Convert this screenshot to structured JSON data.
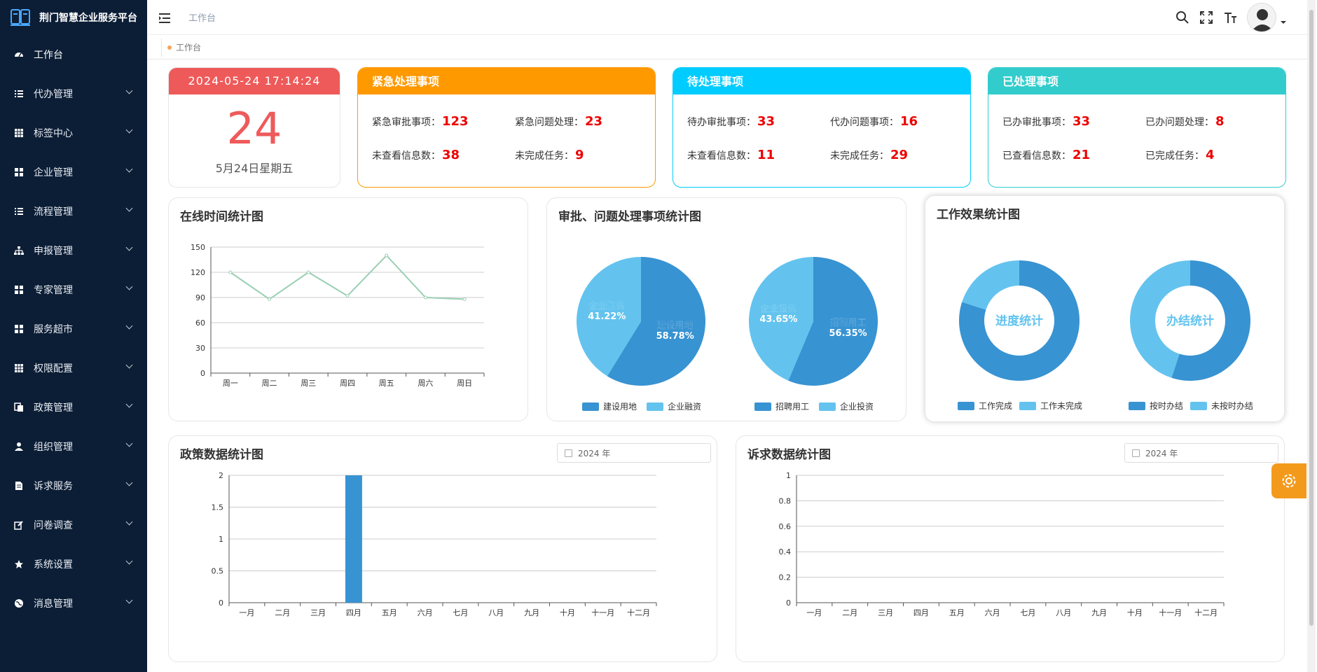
{
  "app": {
    "title": "荆门智慧企业服务平台"
  },
  "sidebar": {
    "items": [
      {
        "label": "工作台",
        "icon": "dashboard-icon",
        "active": true
      },
      {
        "label": "代办管理",
        "icon": "list-icon"
      },
      {
        "label": "标签中心",
        "icon": "grid-icon"
      },
      {
        "label": "企业管理",
        "icon": "apps-icon"
      },
      {
        "label": "流程管理",
        "icon": "list-icon"
      },
      {
        "label": "申报管理",
        "icon": "tree-icon"
      },
      {
        "label": "专家管理",
        "icon": "apps-icon"
      },
      {
        "label": "服务超市",
        "icon": "apps-icon"
      },
      {
        "label": "权限配置",
        "icon": "grid-icon"
      },
      {
        "label": "政策管理",
        "icon": "copy-icon"
      },
      {
        "label": "组织管理",
        "icon": "user-icon"
      },
      {
        "label": "诉求服务",
        "icon": "file-icon"
      },
      {
        "label": "问卷调查",
        "icon": "edit-icon"
      },
      {
        "label": "系统设置",
        "icon": "star-icon"
      },
      {
        "label": "消息管理",
        "icon": "globe-icon"
      }
    ]
  },
  "topbar": {
    "breadcrumb": "工作台"
  },
  "tags": {
    "items": [
      {
        "label": "工作台"
      }
    ]
  },
  "date_card": {
    "datetime": "2024-05-24 17:14:24",
    "day": "24",
    "date_line": "5月24日星期五"
  },
  "stat_cards": [
    {
      "title": "紧急处理事项",
      "color": "#ff9900",
      "items": [
        {
          "label": "紧急审批事项：",
          "value": "123"
        },
        {
          "label": "紧急问题处理：",
          "value": "23"
        },
        {
          "label": "未查看信息数：",
          "value": "38"
        },
        {
          "label": "未完成任务：",
          "value": "9"
        }
      ]
    },
    {
      "title": "待处理事项",
      "color": "#00ccff",
      "items": [
        {
          "label": "待办审批事项：",
          "value": "33"
        },
        {
          "label": "代办问题事项：",
          "value": "16"
        },
        {
          "label": "未查看信息数：",
          "value": "11"
        },
        {
          "label": "未完成任务：",
          "value": "29"
        }
      ]
    },
    {
      "title": "已处理事项",
      "color": "#33cccc",
      "items": [
        {
          "label": "已办审批事项：",
          "value": "33"
        },
        {
          "label": "已办问题处理：",
          "value": "8"
        },
        {
          "label": "已查看信息数：",
          "value": "21"
        },
        {
          "label": "已完成任务：",
          "value": "4"
        }
      ]
    }
  ],
  "colors": {
    "dark_blue": "#3893d2",
    "light_blue": "#63c3ee",
    "line": "#9ad0b4",
    "sidebar_bg": "#0c1e36"
  },
  "chart_data": [
    {
      "type": "line",
      "title": "在线时间统计图",
      "categories": [
        "周一",
        "周二",
        "周三",
        "周四",
        "周五",
        "周六",
        "周日"
      ],
      "values": [
        120,
        88,
        120,
        92,
        140,
        90,
        88
      ],
      "ylim": [
        0,
        150
      ],
      "yticks": [
        0,
        30,
        60,
        90,
        120,
        150
      ]
    },
    {
      "type": "pie",
      "title": "审批、问题处理事项统计图",
      "pies": [
        {
          "slices": [
            {
              "name": "建设用地",
              "value": 58.78,
              "label": "58.78%"
            },
            {
              "name": "企业融资",
              "value": 41.22,
              "label": "41.22%"
            }
          ]
        },
        {
          "slices": [
            {
              "name": "招聘用工",
              "value": 56.35,
              "label": "56.35%"
            },
            {
              "name": "企业投资",
              "value": 43.65,
              "label": "43.65%"
            }
          ]
        }
      ]
    },
    {
      "type": "pie",
      "title": "工作效果统计图",
      "pies": [
        {
          "center": "进度统计",
          "slices": [
            {
              "name": "工作完成",
              "value": 0.8
            },
            {
              "name": "工作未完成",
              "value": 0.2
            }
          ]
        },
        {
          "center": "办结统计",
          "slices": [
            {
              "name": "按时办结",
              "value": 0.55
            },
            {
              "name": "未按时办结",
              "value": 0.45
            }
          ]
        }
      ]
    },
    {
      "type": "bar",
      "title": "政策数据统计图",
      "year": "2024 年",
      "categories": [
        "一月",
        "二月",
        "三月",
        "四月",
        "五月",
        "六月",
        "七月",
        "八月",
        "九月",
        "十月",
        "十一月",
        "十二月"
      ],
      "values": [
        0,
        0,
        0,
        2,
        0,
        0,
        0,
        0,
        0,
        0,
        0,
        0
      ],
      "ylim": [
        0,
        2
      ],
      "yticks": [
        "0",
        "0.5",
        "1",
        "1.5",
        "2"
      ]
    },
    {
      "type": "bar",
      "title": "诉求数据统计图",
      "year": "2024 年",
      "categories": [
        "一月",
        "二月",
        "三月",
        "四月",
        "五月",
        "六月",
        "七月",
        "八月",
        "九月",
        "十月",
        "十一月",
        "十二月"
      ],
      "values": [
        0,
        0,
        0,
        0,
        0,
        0,
        0,
        0,
        0,
        0,
        0,
        0
      ],
      "ylim": [
        0,
        1
      ],
      "yticks": [
        "0",
        "0.2",
        "0.4",
        "0.6",
        "0.8",
        "1"
      ]
    }
  ]
}
